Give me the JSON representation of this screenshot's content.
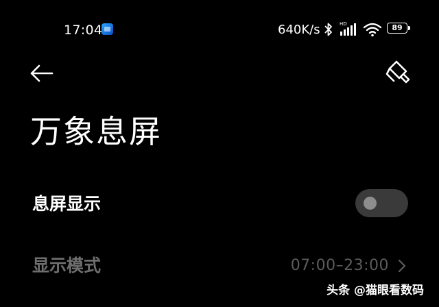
{
  "status_bar": {
    "time": "17:04",
    "network_speed": "640K/s",
    "signal_label": "HD",
    "battery_level": "89",
    "icons": [
      "app-notification-icon",
      "bluetooth-icon",
      "signal-icon",
      "wifi-icon",
      "battery-icon"
    ]
  },
  "header": {
    "back_icon": "arrow-left-icon",
    "action_icon": "paint-roller-icon"
  },
  "page": {
    "title": "万象息屏"
  },
  "settings": {
    "aod": {
      "label": "息屏显示",
      "enabled": false
    },
    "display_mode": {
      "label": "显示模式",
      "value": "07:00–23:00",
      "disabled": true
    }
  },
  "watermark": {
    "text": "头条 @猫眼看数码"
  }
}
